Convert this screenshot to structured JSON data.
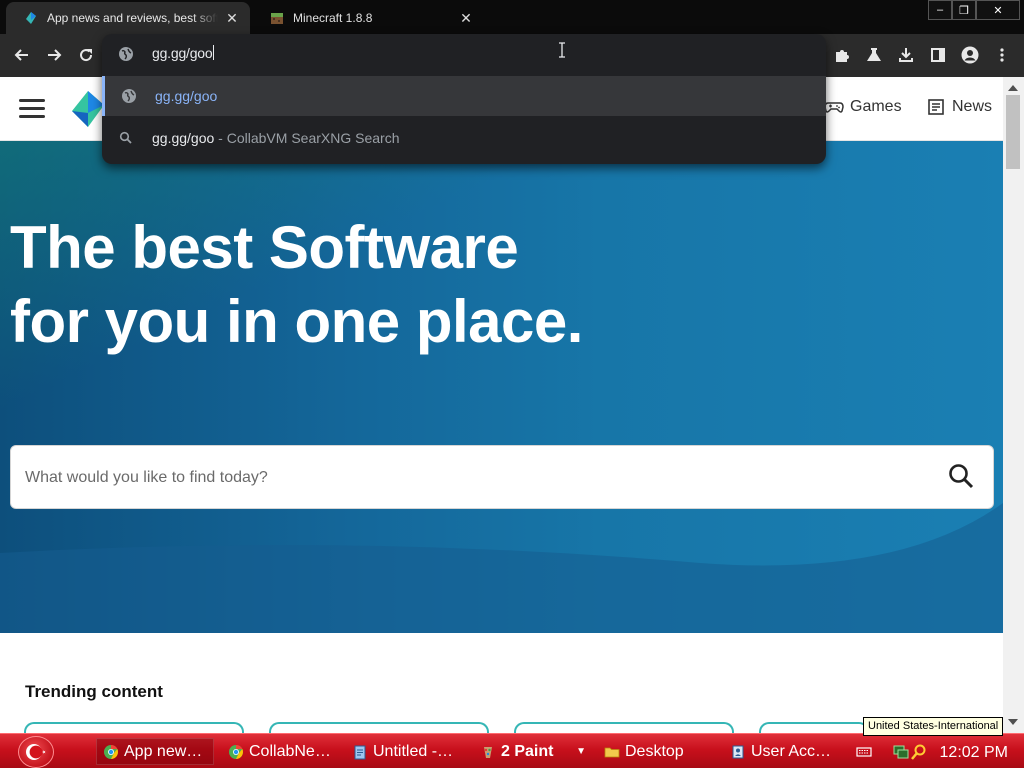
{
  "browser": {
    "tabs": [
      {
        "title": "App news and reviews, best software downloads and discovery",
        "active": true
      },
      {
        "title": "Minecraft 1.8.8",
        "active": false
      }
    ],
    "window_controls": {
      "minimize": "‒",
      "restore": "❐",
      "close": "✕"
    }
  },
  "omnibox": {
    "typed_text": "gg.gg/goo",
    "suggestions": [
      {
        "main": "gg.gg/goo",
        "sub": "",
        "icon": "globe-icon",
        "selected": true
      },
      {
        "main": "gg.gg/goo",
        "sub": " - CollabVM SearXNG Search",
        "icon": "search-icon",
        "selected": false
      }
    ]
  },
  "site": {
    "nav": [
      {
        "label": "Games",
        "icon": "gamepad-icon"
      },
      {
        "label": "News",
        "icon": "newspaper-icon"
      }
    ],
    "hero": {
      "line1": "The best Software",
      "line2": "for you in one place.",
      "search_placeholder": "What would you like to find today?"
    },
    "trending_title": "Trending content"
  },
  "taskbar": {
    "tasks": [
      {
        "label": "App new…",
        "icon": "chrome-icon",
        "active": true
      },
      {
        "label": "CollabNe…",
        "icon": "chrome-icon",
        "active": false
      },
      {
        "label": "Untitled -…",
        "icon": "notepad-icon",
        "active": false
      },
      {
        "label": "2 Paint",
        "icon": "paint-icon",
        "active": false
      },
      {
        "label": "Desktop",
        "icon": "folder-icon",
        "active": false
      },
      {
        "label": "User Acc…",
        "icon": "user-accounts-icon",
        "active": false
      }
    ],
    "clock": "12:02 PM",
    "keyboard_tooltip": "United States-International"
  },
  "colors": {
    "taskbar_red": "#c8101c",
    "hero_blue": "#1776a8",
    "accent_teal": "#35b6b5",
    "link_blue": "#8ab4f8"
  }
}
